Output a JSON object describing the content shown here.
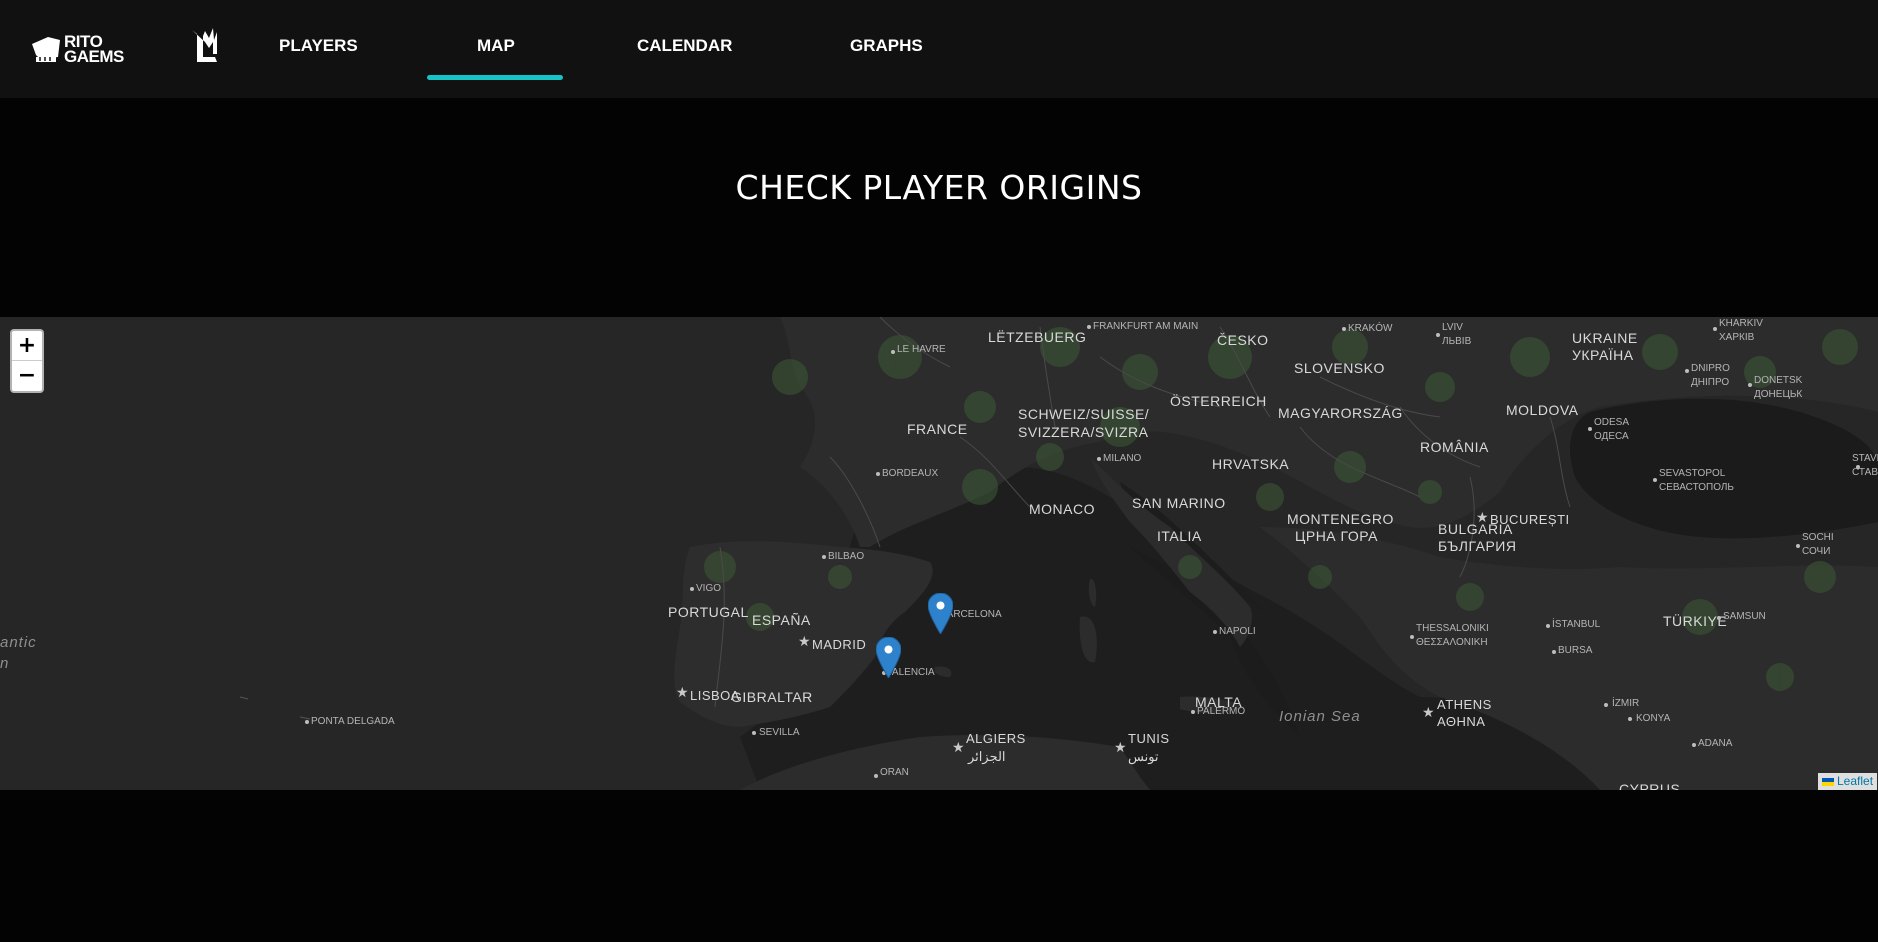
{
  "brand": {
    "line1": "RITO",
    "line2": "GAEMS"
  },
  "nav": {
    "players": "PLAYERS",
    "map": "MAP",
    "calendar": "CALENDAR",
    "graphs": "GRAPHS",
    "active": "MAP"
  },
  "title": "CHECK PLAYER ORIGINS",
  "map": {
    "zoom_in": "+",
    "zoom_out": "−",
    "attribution": "Leaflet",
    "markers": [
      "Barcelona",
      "Valencia"
    ],
    "countries": {
      "letzebuerg": "LËTZEBUERG",
      "cesko": "ČESKO",
      "ukraine": "UKRAINE",
      "ukraina": "УКРАЇНА",
      "slovensko": "SLOVENSKO",
      "osterreich": "ÖSTERREICH",
      "moldova": "MOLDOVA",
      "magyarorszag": "MAGYARORSZÁG",
      "schweiz1": "SCHWEIZ/SUISSE/",
      "schweiz2": "SVIZZERA/SVIZRA",
      "france": "FRANCE",
      "romania": "ROMÂNIA",
      "hrvatska": "HRVATSKA",
      "san_marino": "SAN MARINO",
      "monaco": "MONACO",
      "montenegro": "MONTENEGRO",
      "crna_gora": "ЦРНА ГОРА",
      "bulgaria": "BULGARIA",
      "balgariya": "БЪЛГАРИЯ",
      "italia": "ITALIA",
      "portugal": "PORTUGAL",
      "espana": "ESPAÑA",
      "turkiye": "TÜRKIYE",
      "gibraltar": "GIBRALTAR",
      "malta": "MALTA",
      "cyprus": "CYPRUS"
    },
    "cities": {
      "frankfurt": "FRANKFURT AM MAIN",
      "krakow": "KRAKÓW",
      "lviv": "LVIV",
      "lviv_cyr": "ЛЬВІВ",
      "kharkiv": "KHARKIV",
      "kharkiv_cyr": "ХАРКІВ",
      "le_havre": "LE HAVRE",
      "dnipro": "DNIPRO",
      "dnipro_cyr": "ДНІПРО",
      "donetsk": "DONETSK",
      "donetsk_cyr": "ДОНЕЦЬК",
      "odesa": "ODESA",
      "odesa_cyr": "ОДЕСА",
      "milano": "MILANO",
      "bordeaux": "BORDEAUX",
      "sevastopol": "SEVASTOPOL",
      "sevastopol_cyr": "СЕВАСТОПОЛЬ",
      "stavropol": "STAVR",
      "stavropol_cyr": "СТАВР",
      "bucuresti": "BUCUREȘTI",
      "sochi": "SOCHI",
      "sochi_cyr": "СОЧИ",
      "bilbao": "BILBAO",
      "vigo": "VIGO",
      "barcelona": "BARCELONA",
      "samsun": "SAMSUN",
      "thessaloniki": "THESSALONIKI",
      "thessaloniki_gr": "ΘΕΣΣΑΛΟΝΙΚΗ",
      "istanbul": "İSTANBUL",
      "madrid": "MADRID",
      "napoli": "NAPOLI",
      "bursa": "BURSA",
      "valencia": "VALENCIA",
      "lisboa": "LISBOA",
      "izmir": "İZMIR",
      "athens": "ATHENS",
      "athina": "ΑΘΗΝΑ",
      "palermo": "PALERMO",
      "konya": "KONYA",
      "ponta_delgada": "PONTA DELGADA",
      "sevilla": "SEVILLA",
      "algiers": "ALGIERS",
      "aljazair": "الجزائر",
      "tunis": "TUNIS",
      "tunis_ar": "تونس",
      "adana": "ADANA",
      "oran": "ORAN"
    },
    "seas": {
      "ionian": "Ionian Sea",
      "atlantic1": "antic",
      "atlantic2": "n"
    }
  }
}
